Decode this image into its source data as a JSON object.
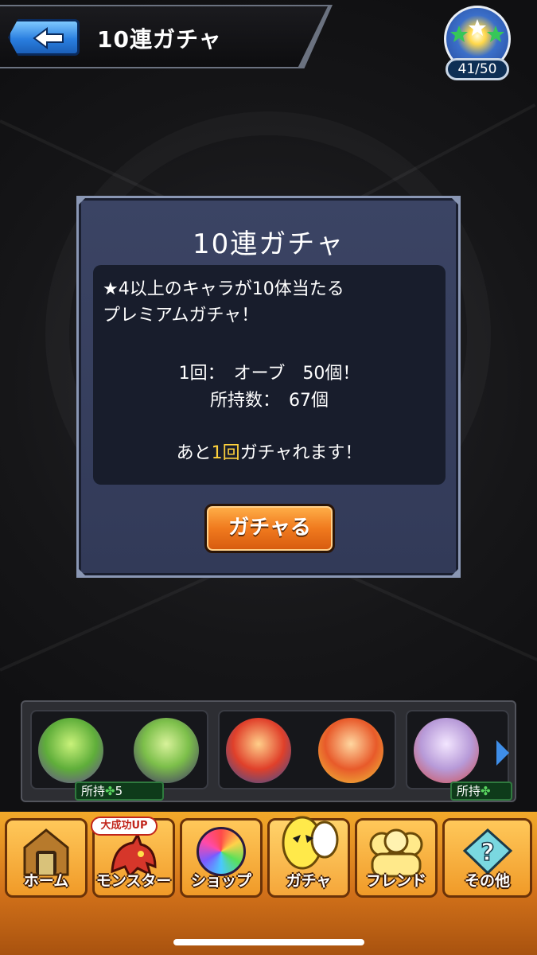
{
  "header": {
    "title": "10連ガチャ",
    "stamina": "41/50"
  },
  "dialog": {
    "title": "10連ガチャ",
    "desc_line1": "★4以上のキャラが10体当たる",
    "desc_line2": "プレミアムガチャ！",
    "cost_line": "1回：　オーブ　50個！",
    "owned_line": "所持数：　67個",
    "remaining_prefix": "あと",
    "remaining_count": "1回",
    "remaining_suffix": "ガチャれます！",
    "button_label": "ガチャる"
  },
  "team_strip": {
    "badge_1": "所持",
    "badge_1_count": "5",
    "badge_3": "所持"
  },
  "nav": {
    "home": "ホーム",
    "monster": "モンスター",
    "monster_badge": "大成功UP",
    "shop": "ショップ",
    "gacha": "ガチャ",
    "friend": "フレンド",
    "other": "その他"
  }
}
